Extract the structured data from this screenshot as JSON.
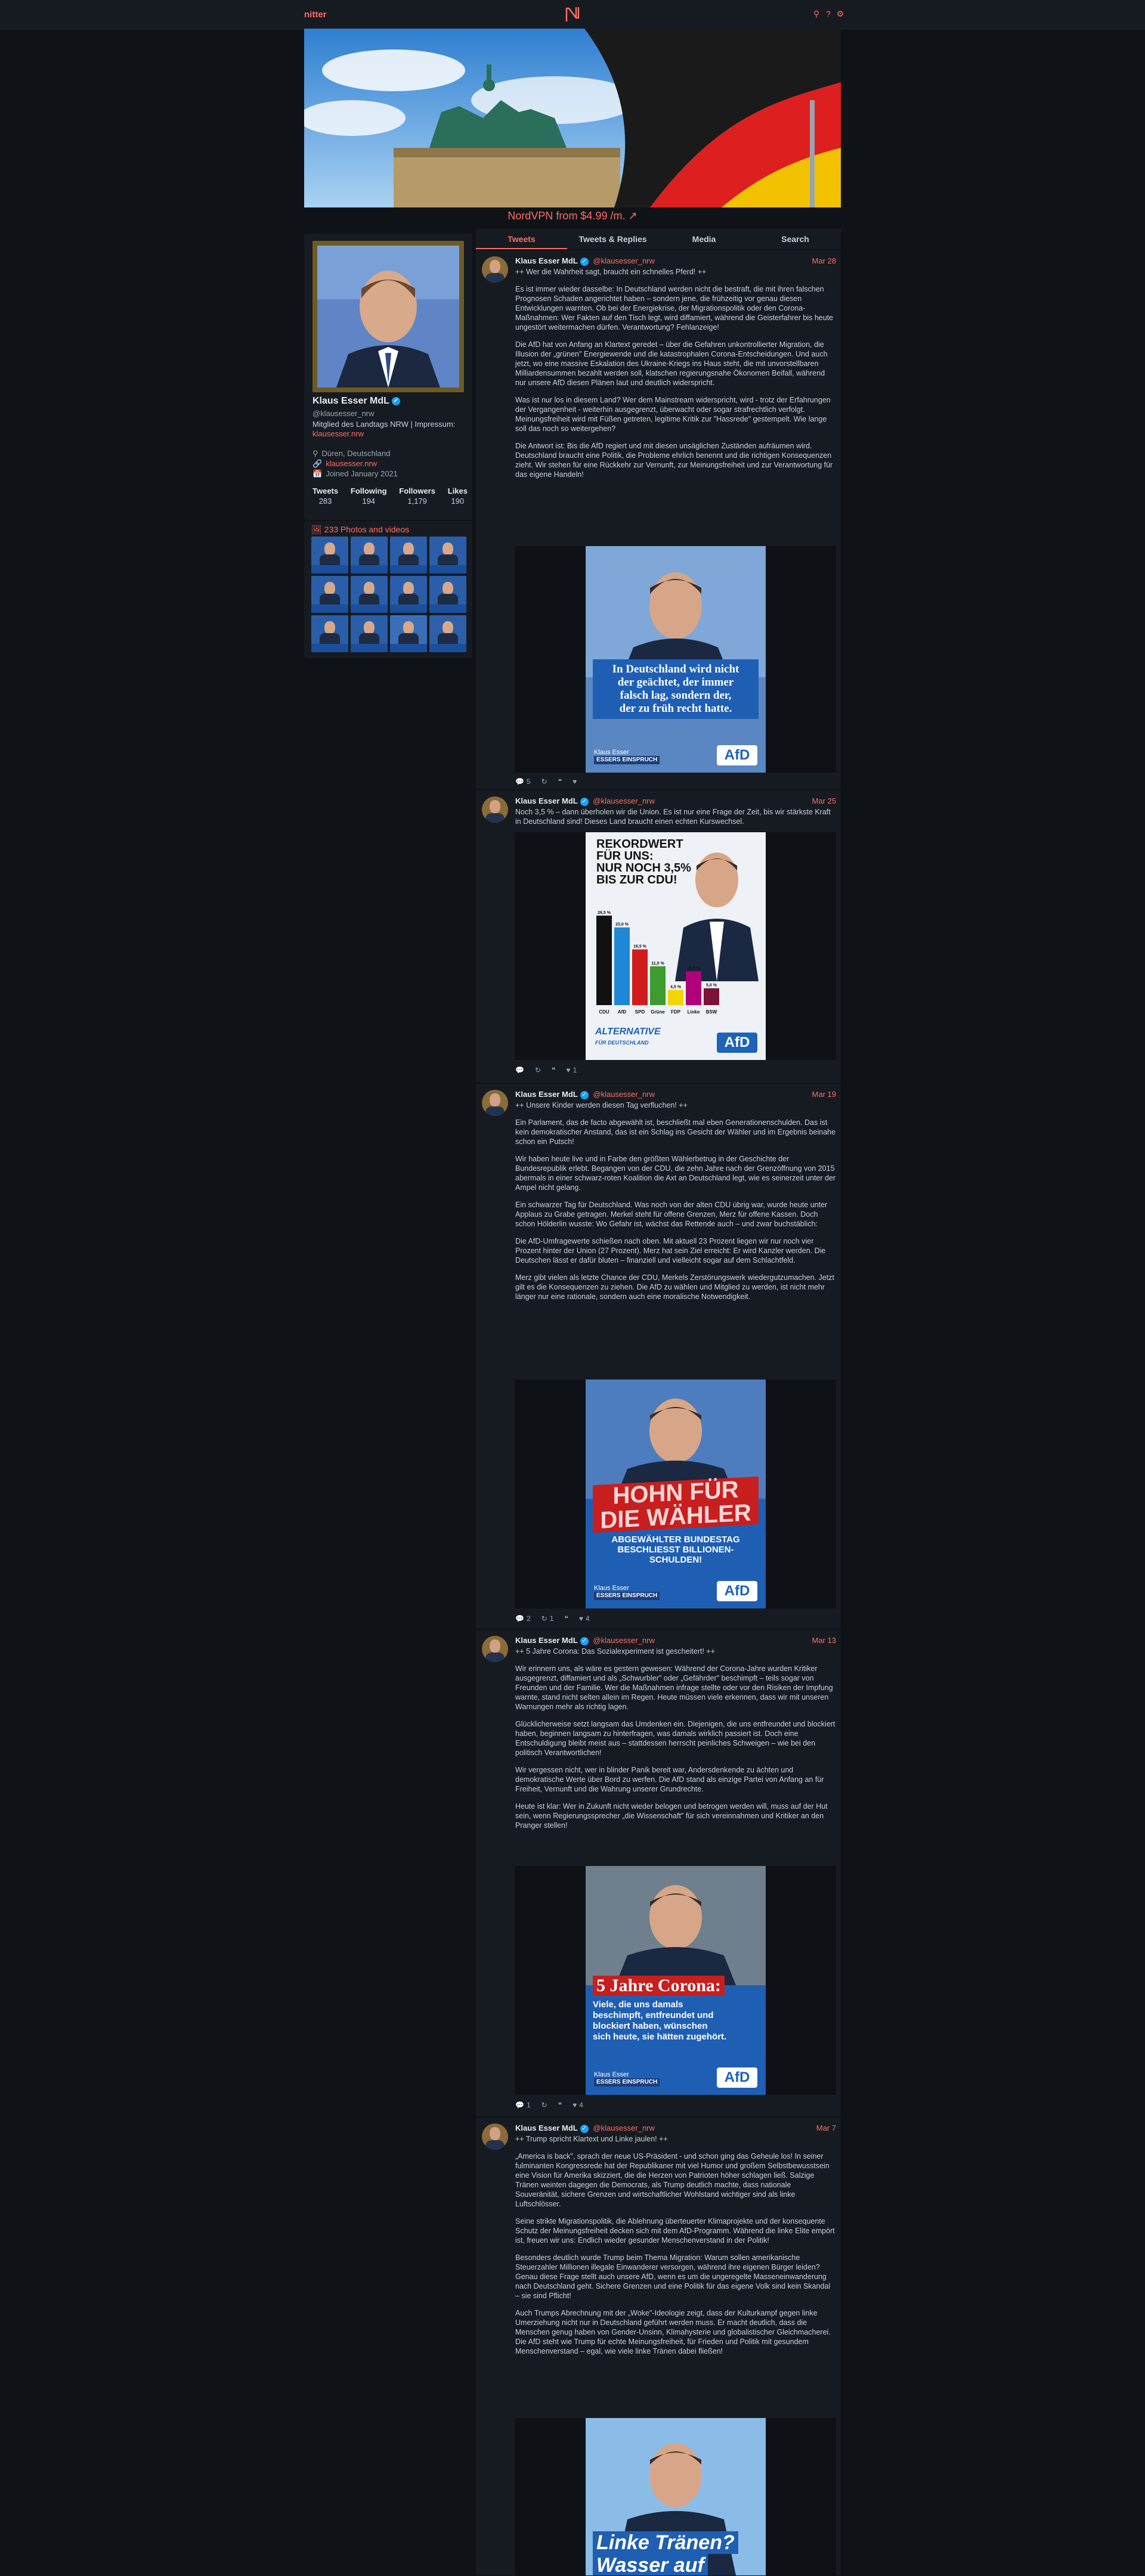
{
  "nav": {
    "brand": "nitter",
    "icons": [
      "search-icon",
      "help-icon",
      "settings-icon"
    ]
  },
  "sponsor": {
    "label": "NordVPN from $4.99 /m."
  },
  "profile": {
    "name": "Klaus Esser MdL",
    "handle": "@klausesser_nrw",
    "bio": "Mitglied des Landtags NRW | Impressum:",
    "bio_link": "klausesser.nrw",
    "location": "Düren, Deutschland",
    "website": "klausesser.nrw",
    "joined": "Joined January 2021",
    "stats": [
      {
        "label": "Tweets",
        "value": "283"
      },
      {
        "label": "Following",
        "value": "194"
      },
      {
        "label": "Followers",
        "value": "1,179"
      },
      {
        "label": "Likes",
        "value": "190"
      }
    ],
    "photos_label": "233 Photos and videos"
  },
  "tabs": [
    "Tweets",
    "Tweets & Replies",
    "Media",
    "Search"
  ],
  "tweets": [
    {
      "date": "Mar 28",
      "paragraphs": [
        "++ Wer die Wahrheit sagt, braucht ein schnelles Pferd! ++",
        "Es ist immer wieder dasselbe: In Deutschland werden nicht die bestraft, die mit ihren falschen Prognosen Schaden angerichtet haben – sondern jene, die frühzeitig vor genau diesen Entwicklungen warnten. Ob bei der Energiekrise, der Migrationspolitik oder den Corona-Maßnahmen: Wer Fakten auf den Tisch legt, wird diffamiert, während die Geisterfahrer bis heute ungestört weitermachen dürfen. Verantwortung? Fehlanzeige!",
        "Die AfD hat von Anfang an Klartext geredet – über die Gefahren unkontrollierter Migration, die Illusion der „grünen\" Energiewende und die katastrophalen Corona-Entscheidungen. Und auch jetzt, wo eine massive Eskalation des Ukraine-Kriegs ins Haus steht, die mit unvorstellbaren Milliardensummen bezahlt werden soll, klatschen regierungsnahe Ökonomen Beifall, während nur unsere AfD diesen Plänen laut und deutlich widerspricht.",
        "Was ist nur los in diesem Land? Wer dem Mainstream widerspricht, wird - trotz der Erfahrungen der Vergangenheit - weiterhin ausgegrenzt, überwacht oder sogar strafrechtlich verfolgt. Meinungsfreiheit wird mit Füßen getreten, legitime Kritik zur \"Hassrede\" gestempelt. Wie lange soll das noch so weitergehen?",
        "Die Antwort ist: Bis die AfD regiert und mit diesen unsäglichen Zuständen aufräumen wird. Deutschland braucht eine Politik, die Probleme ehrlich benennt und die richtigen Konsequenzen zieht. Wir stehen für eine Rückkehr zur Vernunft, zur Meinungsfreiheit und zur Verantwortung für das eigene Handeln!"
      ],
      "poster_text": [
        "In Deutschland wird nicht",
        "der geächtet, der immer",
        "falsch lag, sondern der,",
        "der zu früh recht hatte."
      ],
      "poster_tag": [
        "Klaus Esser",
        "ESSERS EINSPRUCH"
      ],
      "poster_brand": "AfD",
      "actions": {
        "replies": "5",
        "retweets": "",
        "quotes": "",
        "likes": ""
      }
    },
    {
      "date": "Mar 25",
      "paragraphs": [
        "Noch 3,5 % – dann überholen wir die Union. Es ist nur eine Frage der Zeit, bis wir stärkste Kraft in Deutschland sind! Dieses Land braucht einen echten Kurswechsel."
      ],
      "poster_title": [
        "REKORDWERT",
        "FÜR UNS:",
        "NUR NOCH 3,5%",
        "BIS ZUR CDU!"
      ],
      "bars": [
        {
          "party": "CDU",
          "value": 26.5,
          "label": "26,5 %",
          "color": "#111111"
        },
        {
          "party": "AfD",
          "value": 23.0,
          "label": "23,0 %",
          "color": "#1e88d6"
        },
        {
          "party": "SPD",
          "value": 16.5,
          "label": "16,5 %",
          "color": "#d01c1c"
        },
        {
          "party": "Grüne",
          "value": 11.5,
          "label": "11,5 %",
          "color": "#3e9b2f"
        },
        {
          "party": "FDP",
          "value": 4.5,
          "label": "4,5 %",
          "color": "#f2d600"
        },
        {
          "party": "Linke",
          "value": 10.0,
          "label": "10,0 %",
          "color": "#b0007a"
        },
        {
          "party": "BSW",
          "value": 5.0,
          "label": "5,0 %",
          "color": "#7d1237"
        }
      ],
      "poster_logo": [
        "ALTERNATIVE",
        "FÜR DEUTSCHLAND"
      ],
      "poster_brand": "AfD",
      "actions": {
        "replies": "",
        "retweets": "",
        "quotes": "",
        "likes": "1"
      }
    },
    {
      "date": "Mar 19",
      "paragraphs": [
        "++ Unsere Kinder werden diesen Tag verfluchen! ++",
        "Ein Parlament, das de facto abgewählt ist, beschließt mal eben Generationenschulden. Das ist kein demokratischer Anstand, das ist ein Schlag ins Gesicht der Wähler und im Ergebnis beinahe schon ein Putsch!",
        "Wir haben heute live und in Farbe den größten Wählerbetrug in der Geschichte der Bundesrepublik erlebt. Begangen von der CDU, die zehn Jahre nach der Grenzöffnung von 2015 abermals in einer schwarz-roten Koalition die Axt an Deutschland legt, wie es seinerzeit unter der Ampel nicht gelang.",
        "Ein schwarzer Tag für Deutschland. Was noch von der alten CDU übrig war, wurde heute unter Applaus zu Grabe getragen. Merkel steht für offene Grenzen, Merz für offene Kassen. Doch schon Hölderlin wusste: Wo Gefahr ist, wächst das Rettende auch – und zwar buchstäblich:",
        "Die AfD-Umfragewerte schießen nach oben. Mit aktuell 23 Prozent liegen wir nur noch vier Prozent hinter der Union (27 Prozent). Merz hat sein Ziel erreicht: Er wird Kanzler werden. Die Deutschen lässt er dafür bluten – finanziell und vielleicht sogar auf dem Schlachtfeld.",
        "Merz gibt vielen als letzte Chance der CDU, Merkels Zerstörungswerk wiedergutzumachen. Jetzt gilt es die Konsequenzen zu ziehen. Die AfD zu wählen und Mitglied zu werden, ist nicht mehr länger nur eine rationale, sondern auch eine moralische Notwendigkeit."
      ],
      "poster_big": [
        "HOHN FÜR",
        "DIE WÄHLER"
      ],
      "poster_sub": [
        "ABGEWÄHLTER BUNDESTAG",
        "BESCHLIESST BILLIONEN-SCHULDEN!"
      ],
      "poster_tag": [
        "Klaus Esser",
        "ESSERS EINSPRUCH"
      ],
      "poster_brand": "AfD",
      "actions": {
        "replies": "2",
        "retweets": "1",
        "quotes": "",
        "likes": "4"
      }
    },
    {
      "date": "Mar 13",
      "paragraphs": [
        "++ 5 Jahre Corona: Das Sozialexperiment ist gescheitert! ++",
        "Wir erinnern uns, als wäre es gestern gewesen: Während der Corona-Jahre wurden Kritiker ausgegrenzt, diffamiert und als „Schwurbler\" oder „Gefährder\" beschimpft – teils sogar von Freunden und der Familie. Wer die Maßnahmen infrage stellte oder vor den Risiken der Impfung warnte, stand nicht selten allein im Regen. Heute müssen viele erkennen, dass wir mit unseren Warnungen mehr als richtig lagen.",
        "Glücklicherweise setzt langsam das Umdenken ein. Diejenigen, die uns entfreundet und blockiert haben, beginnen langsam zu hinterfragen, was damals wirklich passiert ist. Doch eine Entschuldigung bleibt meist aus – stattdessen herrscht peinliches Schweigen – wie bei den politisch Verantwortlichen!",
        "Wir vergessen nicht, wer in blinder Panik bereit war, Andersdenkende zu ächten und demokratische Werte über Bord zu werfen. Die AfD stand als einzige Partei von Anfang an für Freiheit, Vernunft und die Wahrung unserer Grundrechte.",
        "Heute ist klar: Wer in Zukunft nicht wieder belogen und betrogen werden will, muss auf der Hut sein, wenn Regierungssprecher „die Wissenschaft\" für sich vereinnahmen und Kritiker an den Pranger stellen!"
      ],
      "poster_big": [
        "5 Jahre Corona:"
      ],
      "poster_sub": [
        "Viele, die uns damals",
        "beschimpft, entfreundet und",
        "blockiert haben, wünschen",
        "sich heute, sie hätten zugehört."
      ],
      "poster_tag": [
        "Klaus Esser",
        "ESSERS EINSPRUCH"
      ],
      "poster_brand": "AfD",
      "actions": {
        "replies": "1",
        "retweets": "",
        "quotes": "",
        "likes": "4"
      }
    },
    {
      "date": "Mar 7",
      "paragraphs": [
        "++ Trump spricht Klartext und Linke jaulen! ++",
        "„America is back\", sprach der neue US-Präsident - und schon ging das Geheule los! In seiner fulminanten Kongressrede hat der Republikaner mit viel Humor und großem Selbstbewusstsein eine Vision für Amerika skizziert, die die Herzen von Patrioten höher schlagen ließ. Salzige Tränen weinten dagegen die Democrats, als Trump deutlich machte, dass nationale Souveränität, sichere Grenzen und wirtschaftlicher Wohlstand wichtiger sind als linke Luftschlösser.",
        "Seine strikte Migrationspolitik, die Ablehnung überteuerter Klimaprojekte und der konsequente Schutz der Meinungsfreiheit decken sich mit dem AfD-Programm. Während die linke Elite empört ist, freuen wir uns: Endlich wieder gesunder Menschenverstand in der Politik!",
        "Besonders deutlich wurde Trump beim Thema Migration: Warum sollen amerikanische Steuerzahler Millionen illegale Einwanderer versorgen, während ihre eigenen Bürger leiden? Genau diese Frage stellt auch unsere AfD, wenn es um die ungeregelte Masseneinwanderung nach Deutschland geht. Sichere Grenzen und eine Politik für das eigene Volk sind kein Skandal – sie sind Pflicht!",
        "Auch Trumps Abrechnung mit der „Woke\"-Ideologie zeigt, dass der Kulturkampf gegen linke Umerziehung nicht nur in Deutschland geführt werden muss. Er macht deutlich, dass die Menschen genug haben von Gender-Unsinn, Klimahysterie und globalistischer Gleichmacherei. Die AfD steht wie Trump für echte Meinungsfreiheit, für Frieden und Politik mit gesundem Menschenverstand – egal, wie viele linke Tränen dabei fließen!"
      ],
      "poster_big": [
        "Linke Tränen?",
        "Wasser auf"
      ],
      "actions": {
        "replies": "",
        "retweets": "",
        "quotes": "",
        "likes": ""
      }
    }
  ]
}
